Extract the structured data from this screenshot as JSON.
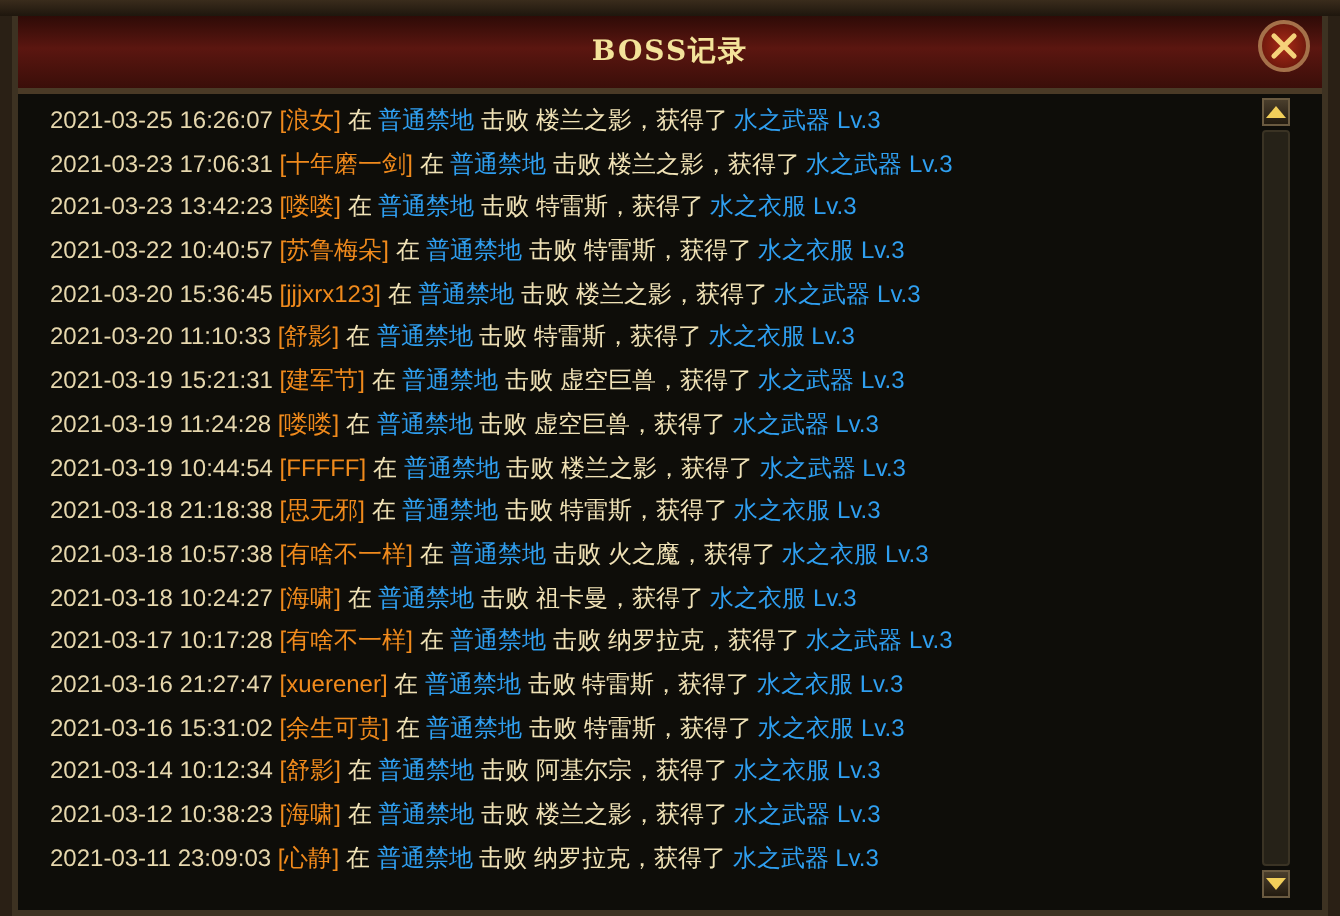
{
  "window": {
    "title": "BOSS记录"
  },
  "records": [
    {
      "time": "2021-03-25 16:26:07",
      "player": "[浪女]",
      "at": "在",
      "map": "普通禁地",
      "defeat": "击败",
      "boss": "楼兰之影",
      "obtain": "，获得了",
      "item": "水之武器 Lv.3"
    },
    {
      "time": "2021-03-23 17:06:31",
      "player": "[十年磨一剑]",
      "at": "在",
      "map": "普通禁地",
      "defeat": "击败",
      "boss": "楼兰之影",
      "obtain": "，获得了",
      "item": "水之武器 Lv.3"
    },
    {
      "time": "2021-03-23 13:42:23",
      "player": "[喽喽]",
      "at": "在",
      "map": "普通禁地",
      "defeat": "击败",
      "boss": "特雷斯",
      "obtain": "，获得了",
      "item": "水之衣服 Lv.3"
    },
    {
      "time": "2021-03-22 10:40:57",
      "player": "[苏鲁梅朵]",
      "at": "在",
      "map": "普通禁地",
      "defeat": "击败",
      "boss": "特雷斯",
      "obtain": "，获得了",
      "item": "水之衣服 Lv.3"
    },
    {
      "time": "2021-03-20 15:36:45",
      "player": "[jjjxrx123]",
      "at": "在",
      "map": "普通禁地",
      "defeat": "击败",
      "boss": "楼兰之影",
      "obtain": "，获得了",
      "item": "水之武器 Lv.3"
    },
    {
      "time": "2021-03-20 11:10:33",
      "player": "[舒影]",
      "at": "在",
      "map": "普通禁地",
      "defeat": "击败",
      "boss": "特雷斯",
      "obtain": "，获得了",
      "item": "水之衣服 Lv.3"
    },
    {
      "time": "2021-03-19 15:21:31",
      "player": "[建军节]",
      "at": "在",
      "map": "普通禁地",
      "defeat": "击败",
      "boss": "虚空巨兽",
      "obtain": "，获得了",
      "item": "水之武器 Lv.3"
    },
    {
      "time": "2021-03-19 11:24:28",
      "player": "[喽喽]",
      "at": "在",
      "map": "普通禁地",
      "defeat": "击败",
      "boss": "虚空巨兽",
      "obtain": "，获得了",
      "item": "水之武器 Lv.3"
    },
    {
      "time": "2021-03-19 10:44:54",
      "player": "[FFFFF]",
      "at": "在",
      "map": "普通禁地",
      "defeat": "击败",
      "boss": "楼兰之影",
      "obtain": "，获得了",
      "item": "水之武器 Lv.3"
    },
    {
      "time": "2021-03-18 21:18:38",
      "player": "[思无邪]",
      "at": "在",
      "map": "普通禁地",
      "defeat": "击败",
      "boss": "特雷斯",
      "obtain": "，获得了",
      "item": "水之衣服 Lv.3"
    },
    {
      "time": "2021-03-18 10:57:38",
      "player": "[有啥不一样]",
      "at": "在",
      "map": "普通禁地",
      "defeat": "击败",
      "boss": "火之魔",
      "obtain": "，获得了",
      "item": "水之衣服 Lv.3"
    },
    {
      "time": "2021-03-18 10:24:27",
      "player": "[海啸]",
      "at": "在",
      "map": "普通禁地",
      "defeat": "击败",
      "boss": "祖卡曼",
      "obtain": "，获得了",
      "item": "水之衣服 Lv.3"
    },
    {
      "time": "2021-03-17 10:17:28",
      "player": "[有啥不一样]",
      "at": "在",
      "map": "普通禁地",
      "defeat": "击败",
      "boss": "纳罗拉克",
      "obtain": "，获得了",
      "item": "水之武器 Lv.3"
    },
    {
      "time": "2021-03-16 21:27:47",
      "player": "[xuerener]",
      "at": "在",
      "map": "普通禁地",
      "defeat": "击败",
      "boss": "特雷斯",
      "obtain": "，获得了",
      "item": "水之衣服 Lv.3"
    },
    {
      "time": "2021-03-16 15:31:02",
      "player": "[余生可贵]",
      "at": "在",
      "map": "普通禁地",
      "defeat": "击败",
      "boss": "特雷斯",
      "obtain": "，获得了",
      "item": "水之衣服 Lv.3"
    },
    {
      "time": "2021-03-14 10:12:34",
      "player": "[舒影]",
      "at": "在",
      "map": "普通禁地",
      "defeat": "击败",
      "boss": "阿基尔宗",
      "obtain": "，获得了",
      "item": "水之衣服 Lv.3"
    },
    {
      "time": "2021-03-12 10:38:23",
      "player": "[海啸]",
      "at": "在",
      "map": "普通禁地",
      "defeat": "击败",
      "boss": "楼兰之影",
      "obtain": "，获得了",
      "item": "水之武器 Lv.3"
    },
    {
      "time": "2021-03-11 23:09:03",
      "player": "[心静]",
      "at": "在",
      "map": "普通禁地",
      "defeat": "击败",
      "boss": "纳罗拉克",
      "obtain": "，获得了",
      "item": "水之武器 Lv.3"
    }
  ]
}
